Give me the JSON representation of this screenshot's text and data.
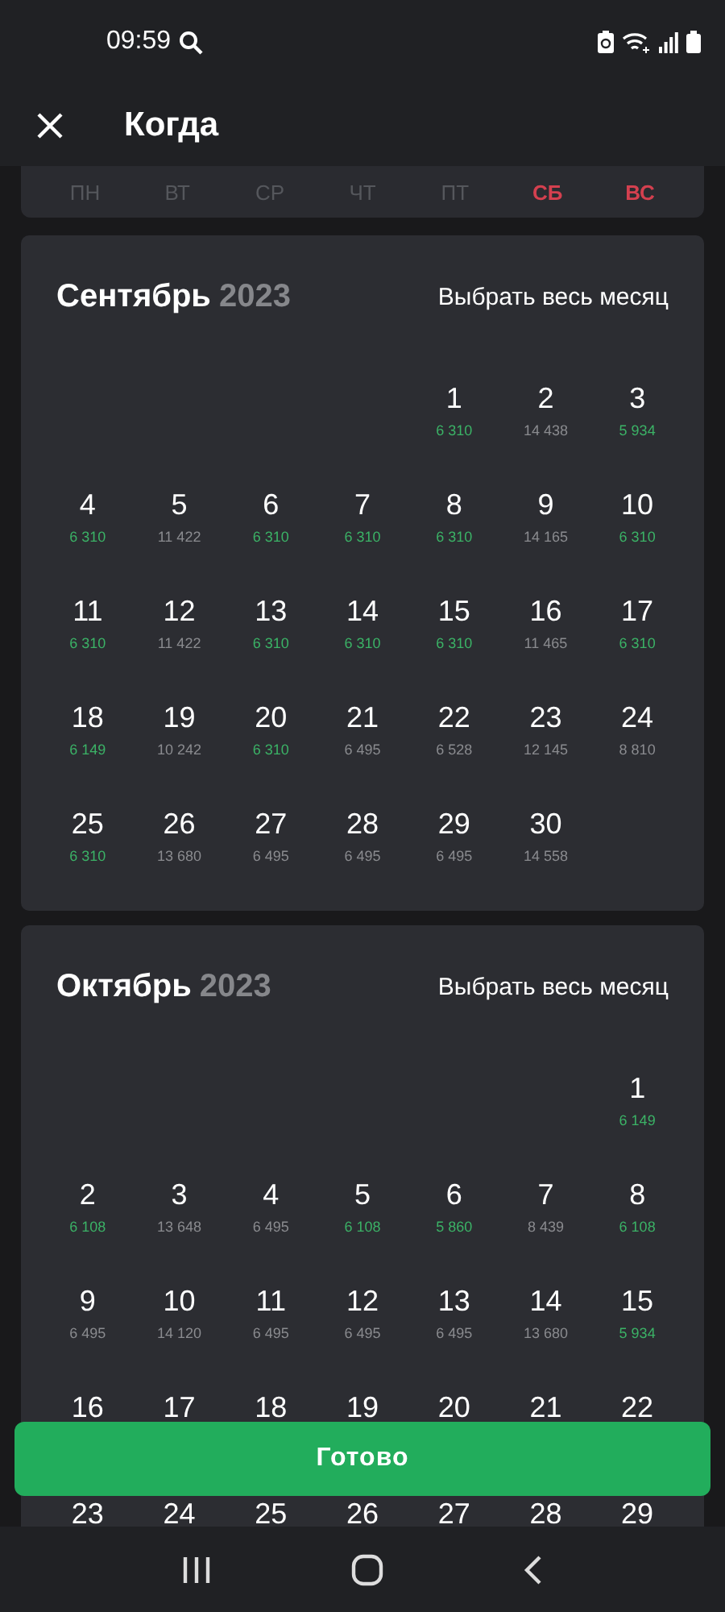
{
  "status_bar": {
    "time": "09:59"
  },
  "header": {
    "title": "Когда"
  },
  "weekdays": [
    {
      "label": "ПН",
      "weekend": false
    },
    {
      "label": "ВТ",
      "weekend": false
    },
    {
      "label": "СР",
      "weekend": false
    },
    {
      "label": "ЧТ",
      "weekend": false
    },
    {
      "label": "ПТ",
      "weekend": false
    },
    {
      "label": "СБ",
      "weekend": true
    },
    {
      "label": "ВС",
      "weekend": true
    }
  ],
  "months": [
    {
      "title": "Сентябрь",
      "year": "2023",
      "select_all": "Выбрать весь месяц",
      "weeks": [
        {
          "days": [
            {
              "day": "1",
              "price": "6 310",
              "cheap": true
            },
            {
              "day": "2",
              "price": "14 438",
              "cheap": false
            },
            {
              "day": "3",
              "price": "5 934",
              "cheap": true
            }
          ]
        },
        {
          "days": [
            {
              "day": "4",
              "price": "6 310",
              "cheap": true
            },
            {
              "day": "5",
              "price": "11 422",
              "cheap": false
            },
            {
              "day": "6",
              "price": "6 310",
              "cheap": true
            },
            {
              "day": "7",
              "price": "6 310",
              "cheap": true
            },
            {
              "day": "8",
              "price": "6 310",
              "cheap": true
            },
            {
              "day": "9",
              "price": "14 165",
              "cheap": false
            },
            {
              "day": "10",
              "price": "6 310",
              "cheap": true
            }
          ]
        },
        {
          "days": [
            {
              "day": "11",
              "price": "6 310",
              "cheap": true
            },
            {
              "day": "12",
              "price": "11 422",
              "cheap": false
            },
            {
              "day": "13",
              "price": "6 310",
              "cheap": true
            },
            {
              "day": "14",
              "price": "6 310",
              "cheap": true
            },
            {
              "day": "15",
              "price": "6 310",
              "cheap": true
            },
            {
              "day": "16",
              "price": "11 465",
              "cheap": false
            },
            {
              "day": "17",
              "price": "6 310",
              "cheap": true
            }
          ]
        },
        {
          "days": [
            {
              "day": "18",
              "price": "6 149",
              "cheap": true
            },
            {
              "day": "19",
              "price": "10 242",
              "cheap": false
            },
            {
              "day": "20",
              "price": "6 310",
              "cheap": true
            },
            {
              "day": "21",
              "price": "6 495",
              "cheap": false
            },
            {
              "day": "22",
              "price": "6 528",
              "cheap": false
            },
            {
              "day": "23",
              "price": "12 145",
              "cheap": false
            },
            {
              "day": "24",
              "price": "8 810",
              "cheap": false
            }
          ]
        },
        {
          "days": [
            {
              "day": "25",
              "price": "6 310",
              "cheap": true
            },
            {
              "day": "26",
              "price": "13 680",
              "cheap": false
            },
            {
              "day": "27",
              "price": "6 495",
              "cheap": false
            },
            {
              "day": "28",
              "price": "6 495",
              "cheap": false
            },
            {
              "day": "29",
              "price": "6 495",
              "cheap": false
            },
            {
              "day": "30",
              "price": "14 558",
              "cheap": false
            }
          ]
        }
      ]
    },
    {
      "title": "Октябрь",
      "year": "2023",
      "select_all": "Выбрать весь месяц",
      "weeks": [
        {
          "days": [
            {
              "day": "1",
              "price": "6 149",
              "cheap": true
            }
          ]
        },
        {
          "days": [
            {
              "day": "2",
              "price": "6 108",
              "cheap": true
            },
            {
              "day": "3",
              "price": "13 648",
              "cheap": false
            },
            {
              "day": "4",
              "price": "6 495",
              "cheap": false
            },
            {
              "day": "5",
              "price": "6 108",
              "cheap": true
            },
            {
              "day": "6",
              "price": "5 860",
              "cheap": true
            },
            {
              "day": "7",
              "price": "8 439",
              "cheap": false
            },
            {
              "day": "8",
              "price": "6 108",
              "cheap": true
            }
          ]
        },
        {
          "days": [
            {
              "day": "9",
              "price": "6 495",
              "cheap": false
            },
            {
              "day": "10",
              "price": "14 120",
              "cheap": false
            },
            {
              "day": "11",
              "price": "6 495",
              "cheap": false
            },
            {
              "day": "12",
              "price": "6 495",
              "cheap": false
            },
            {
              "day": "13",
              "price": "6 495",
              "cheap": false
            },
            {
              "day": "14",
              "price": "13 680",
              "cheap": false
            },
            {
              "day": "15",
              "price": "5 934",
              "cheap": true
            }
          ]
        },
        {
          "days": [
            {
              "day": "16"
            },
            {
              "day": "17"
            },
            {
              "day": "18"
            },
            {
              "day": "19"
            },
            {
              "day": "20"
            },
            {
              "day": "21"
            },
            {
              "day": "22"
            }
          ]
        },
        {
          "days": [
            {
              "day": "23"
            },
            {
              "day": "24"
            },
            {
              "day": "25"
            },
            {
              "day": "26"
            },
            {
              "day": "27"
            },
            {
              "day": "28"
            },
            {
              "day": "29"
            }
          ]
        }
      ]
    }
  ],
  "done_button": {
    "label": "Готово"
  }
}
